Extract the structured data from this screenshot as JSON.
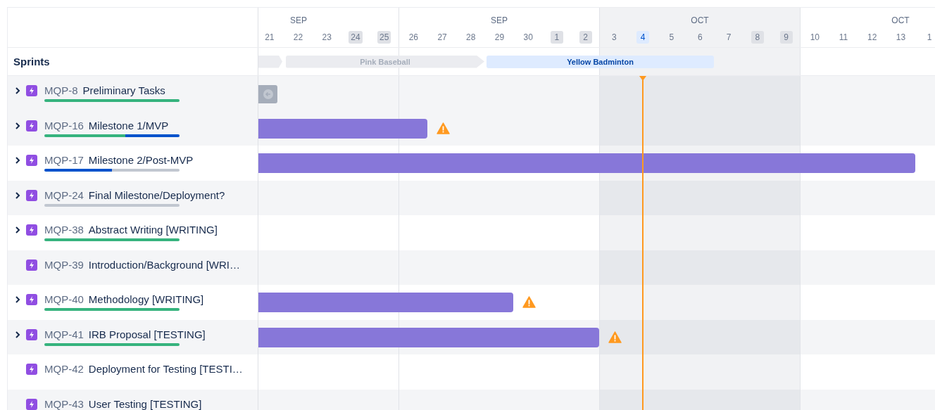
{
  "timeline": {
    "weeks": [
      {
        "month": "SEP",
        "shaded": false,
        "days": [
          {
            "label": "21",
            "weekend": false,
            "today": false
          },
          {
            "label": "22",
            "weekend": false,
            "today": false
          },
          {
            "label": "23",
            "weekend": false,
            "today": false
          },
          {
            "label": "24",
            "weekend": true,
            "today": false
          },
          {
            "label": "25",
            "weekend": true,
            "today": false
          }
        ]
      },
      {
        "month": "SEP",
        "shaded": false,
        "days": [
          {
            "label": "26",
            "weekend": false,
            "today": false
          },
          {
            "label": "27",
            "weekend": false,
            "today": false
          },
          {
            "label": "28",
            "weekend": false,
            "today": false
          },
          {
            "label": "29",
            "weekend": false,
            "today": false
          },
          {
            "label": "30",
            "weekend": false,
            "today": false
          },
          {
            "label": "1",
            "weekend": true,
            "today": false
          },
          {
            "label": "2",
            "weekend": true,
            "today": false
          }
        ]
      },
      {
        "month": "OCT",
        "shaded": true,
        "days": [
          {
            "label": "3",
            "weekend": false,
            "today": false
          },
          {
            "label": "4",
            "weekend": false,
            "today": true
          },
          {
            "label": "5",
            "weekend": false,
            "today": false
          },
          {
            "label": "6",
            "weekend": false,
            "today": false
          },
          {
            "label": "7",
            "weekend": false,
            "today": false
          },
          {
            "label": "8",
            "weekend": true,
            "today": false
          },
          {
            "label": "9",
            "weekend": true,
            "today": false
          }
        ]
      },
      {
        "month": "OCT",
        "shaded": false,
        "days": [
          {
            "label": "10",
            "weekend": false,
            "today": false
          },
          {
            "label": "11",
            "weekend": false,
            "today": false
          },
          {
            "label": "12",
            "weekend": false,
            "today": false
          },
          {
            "label": "13",
            "weekend": false,
            "today": false
          },
          {
            "label": "1",
            "weekend": false,
            "today": false
          }
        ]
      }
    ]
  },
  "sprints": {
    "label": "Sprints",
    "items": [
      {
        "active": false
      },
      {
        "name": "Pink Baseball",
        "active": false
      },
      {
        "name": "Yellow Badminton",
        "active": true
      }
    ]
  },
  "rows": [
    {
      "key": "MQP-8",
      "title": "Preliminary Tasks",
      "expandable": true,
      "selected": true,
      "progress": [
        {
          "kind": "done",
          "level": 1
        }
      ],
      "bar": {
        "kind": "offscreen"
      }
    },
    {
      "key": "MQP-16",
      "title": "Milestone 1/MVP",
      "expandable": true,
      "selected": false,
      "progress": [
        {
          "kind": "done",
          "level": 0.6
        },
        {
          "kind": "in_progress",
          "level": 0.4
        }
      ],
      "bar": {
        "kind": "bar",
        "warning": true
      }
    },
    {
      "key": "MQP-17",
      "title": "Milestone 2/Post-MVP",
      "expandable": true,
      "selected": false,
      "progress": [
        {
          "kind": "in_progress",
          "level": 0.5
        },
        {
          "kind": "todo",
          "level": 0.5
        }
      ],
      "bar": {
        "kind": "bar"
      }
    },
    {
      "key": "MQP-24",
      "title": "Final Milestone/Deployment?",
      "expandable": true,
      "selected": false,
      "progress": [
        {
          "kind": "todo",
          "level": 1
        }
      ]
    },
    {
      "key": "MQP-38",
      "title": "Abstract Writing [WRITING]",
      "expandable": true,
      "selected": false,
      "progress": [
        {
          "kind": "done",
          "level": 1
        }
      ]
    },
    {
      "key": "MQP-39",
      "title": "Introduction/Background [WRI…",
      "expandable": false,
      "selected": false
    },
    {
      "key": "MQP-40",
      "title": "Methodology [WRITING]",
      "expandable": true,
      "selected": false,
      "progress": [
        {
          "kind": "done",
          "level": 1
        }
      ],
      "bar": {
        "kind": "bar",
        "warning": true
      }
    },
    {
      "key": "MQP-41",
      "title": "IRB Proposal [TESTING]",
      "expandable": true,
      "selected": false,
      "progress": [
        {
          "kind": "done",
          "level": 1
        }
      ],
      "bar": {
        "kind": "bar",
        "warning": true
      }
    },
    {
      "key": "MQP-42",
      "title": "Deployment for Testing [TESTI…",
      "expandable": false,
      "selected": false
    },
    {
      "key": "MQP-43",
      "title": "User Testing [TESTING]",
      "expandable": false,
      "selected": false
    }
  ]
}
